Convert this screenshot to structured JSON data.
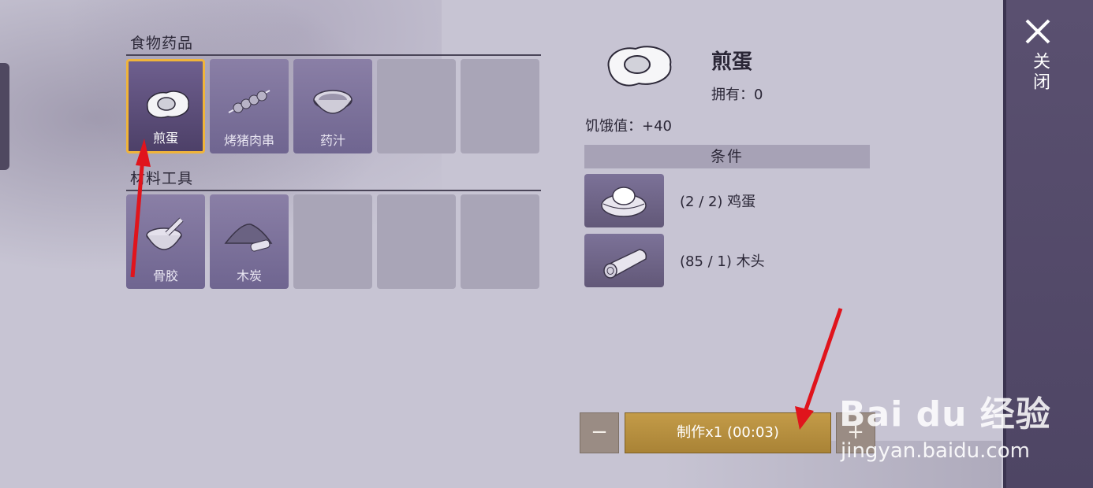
{
  "sections": {
    "food": {
      "title": "食物药品",
      "items": [
        {
          "label": "煎蛋",
          "icon": "fried-egg"
        },
        {
          "label": "烤猪肉串",
          "icon": "pork-skewer"
        },
        {
          "label": "药汁",
          "icon": "medicine-bowl"
        }
      ]
    },
    "materials": {
      "title": "材料工具",
      "items": [
        {
          "label": "骨胶",
          "icon": "mortar-pestle"
        },
        {
          "label": "木炭",
          "icon": "charcoal-pile"
        }
      ]
    }
  },
  "detail": {
    "name": "煎蛋",
    "owned": "拥有：0",
    "hunger": "饥饿值：+40",
    "conditions_title": "条件",
    "conditions": [
      {
        "text": "(2 / 2) 鸡蛋",
        "icon": "egg-nest"
      },
      {
        "text": "(85 / 1) 木头",
        "icon": "wood-log"
      }
    ]
  },
  "actions": {
    "minus": "−",
    "craft": "制作x1 (00:03)",
    "plus": "+"
  },
  "close_label": "关闭",
  "watermark": {
    "main": "Bai du 经验",
    "sub": "jingyan.baidu.com"
  },
  "colors": {
    "selected_border": "#f0b43a",
    "craft_button": "#c39b48",
    "side_panel": "#5a5070",
    "arrow": "#e0141c"
  }
}
